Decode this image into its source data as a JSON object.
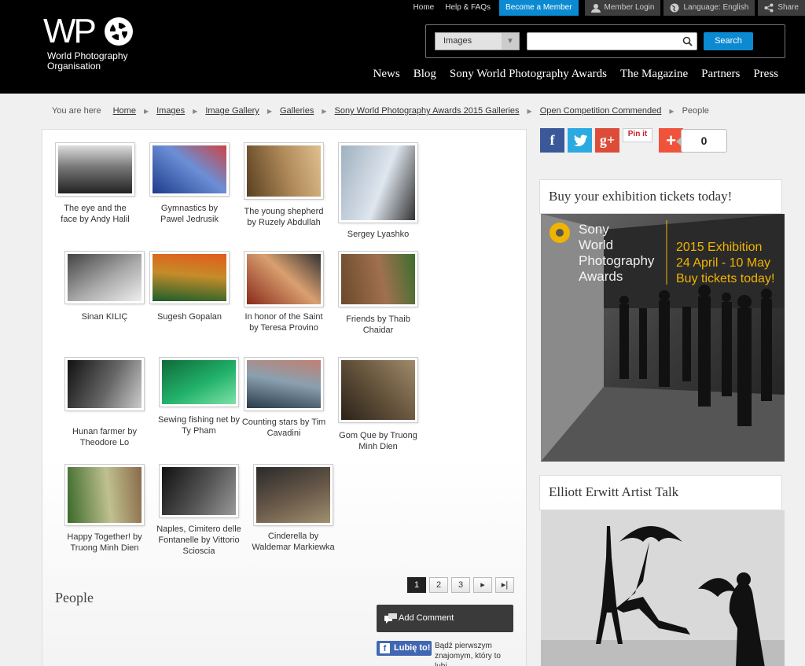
{
  "logo": {
    "letters": "WP",
    "subtitle_line1": "World Photography",
    "subtitle_line2": "Organisation"
  },
  "topnav": {
    "home": "Home",
    "help": "Help & FAQs",
    "become_member": "Become a Member",
    "member_login": "Member Login",
    "language": "Language: English",
    "share": "Share"
  },
  "search": {
    "category": "Images",
    "query": "",
    "button": "Search"
  },
  "mainnav": [
    "News",
    "Blog",
    "Sony World Photography Awards",
    "The Magazine",
    "Partners",
    "Press"
  ],
  "breadcrumb": {
    "prefix": "You are here",
    "links": [
      "Home",
      "Images",
      "Image Gallery",
      "Galleries",
      "Sony World Photography Awards 2015 Galleries",
      "Open Competition Commended"
    ],
    "current": "People"
  },
  "gallery": [
    {
      "caption": "The eye and the face by Andy Halil"
    },
    {
      "caption": "Gymnastics by Pawel Jedrusik"
    },
    {
      "caption": "The young shepherd by Ruzely Abdullah"
    },
    {
      "caption": "Sergey Lyashko"
    },
    {
      "caption": "Sinan KILIÇ"
    },
    {
      "caption": "Sugesh Gopalan"
    },
    {
      "caption": "In honor of the Saint by Teresa Provino"
    },
    {
      "caption": "Friends by Thaib Chaidar"
    },
    {
      "caption": "Hunan farmer by Theodore Lo"
    },
    {
      "caption": "Sewing fishing net by Ty Pham"
    },
    {
      "caption": "Counting stars by Tim Cavadini"
    },
    {
      "caption": "Gom Que by Truong Minh Dien"
    },
    {
      "caption": "Happy Together! by Truong Minh Dien"
    },
    {
      "caption": "Naples, Cimitero delle Fontanelle by Vittorio Scioscia"
    },
    {
      "caption": "Cinderella by Waldemar Markiewka"
    }
  ],
  "pagination": {
    "pages": [
      "1",
      "2",
      "3"
    ],
    "current": "1",
    "next": "›",
    "last": "›|"
  },
  "section_title": "People",
  "add_comment": "Add Comment",
  "facebook": {
    "like": "Lubię to!",
    "text": "Bądź pierwszym znajomym, który to lubi"
  },
  "share_bar": {
    "count": "0",
    "pinit": "Pin it"
  },
  "exhibition": {
    "title": "Buy your exhibition tickets today!",
    "promo_line1": "Sony",
    "promo_line2": "World",
    "promo_line3": "Photography",
    "promo_line4": "Awards",
    "promo_line5": "2015 Exhibition",
    "promo_line6": "24 April - 10 May",
    "promo_line7": "Buy tickets today!"
  },
  "talk": {
    "title": "Elliott Erwitt Artist Talk"
  },
  "colors": {
    "header_bg": "#000000",
    "accent_blue": "#0b8ad1",
    "promo_gold": "#f0b400"
  }
}
